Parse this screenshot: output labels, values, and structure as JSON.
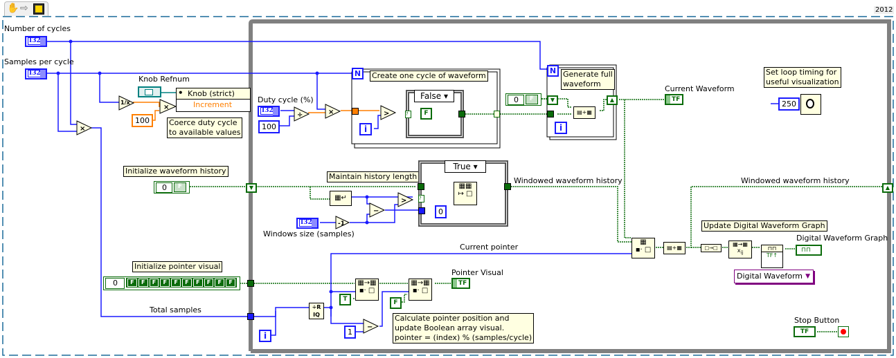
{
  "toolbar": {
    "icons": [
      "hand-tool-icon",
      "arrow-tool-icon",
      "run-continuously-icon"
    ],
    "version_badge": "2012"
  },
  "controls": {
    "number_of_cycles": {
      "label": "Number of cycles",
      "type": "I32"
    },
    "samples_per_cycle": {
      "label": "Samples per cycle",
      "type": "I32"
    },
    "duty_cycle": {
      "label": "Duty cycle (%)",
      "type": "I32"
    },
    "windows_size": {
      "label": "Windows size (samples)",
      "type": "I32"
    },
    "knob_refnum": {
      "label": "Knob Refnum"
    },
    "stop_button": {
      "label": "Stop Button",
      "type": "TF"
    }
  },
  "property_node": {
    "class": "Knob (strict)",
    "property": "Increment"
  },
  "constants": {
    "hundred_a": "100",
    "hundred_b": "100",
    "wait_ms": "250",
    "zero_index": "0",
    "one": "1",
    "array_index_wave": "0",
    "array_index_history": "0",
    "array_index_pointer": "0",
    "bool_false": "F",
    "bool_true": "T",
    "pointer_visual_elements": [
      "F",
      "F",
      "F",
      "F",
      "F",
      "F",
      "F",
      "F",
      "F",
      "F"
    ]
  },
  "comments": {
    "coerce": "Coerce duty cycle\nto available values",
    "create_cycle": "Create one cycle of waveform",
    "generate_full": "Generate full\nwaveform",
    "loop_timing": "Set loop timing for\nuseful visualization",
    "init_history": "Initialize waveform history",
    "maintain_history": "Maintain history length",
    "init_pointer": "Initialize pointer visual",
    "update_graph": "Update Digital Waveform Graph",
    "calc_pointer": "Calculate pointer position and\nupdate Boolean array visual.\npointer = (index) % (samples/cycle)"
  },
  "case_structures": {
    "waveform_case": "False",
    "history_case": "True"
  },
  "wire_labels": {
    "windowed_history_a": "Windowed waveform history",
    "windowed_history_b": "Windowed waveform history",
    "current_pointer": "Current pointer",
    "total_samples": "Total samples"
  },
  "indicators": {
    "current_waveform": {
      "label": "Current Waveform",
      "type": "TF"
    },
    "pointer_visual": {
      "label": "Pointer Visual",
      "type": "TF"
    },
    "digital_waveform_graph": {
      "label": "Digital Waveform Graph"
    }
  },
  "typedef_dropdown": {
    "value": "Digital Waveform"
  },
  "loops": {
    "for_loop_count": "N",
    "iteration": "i"
  },
  "colors": {
    "integer_wire": "#1a1aff",
    "boolean_wire": "#0a6b0a",
    "float_wire": "#ff7f00",
    "refnum_wire": "#008080",
    "while_loop_border": "#808080",
    "comment_bg": "#ffffe1",
    "typedef": "#800080"
  }
}
